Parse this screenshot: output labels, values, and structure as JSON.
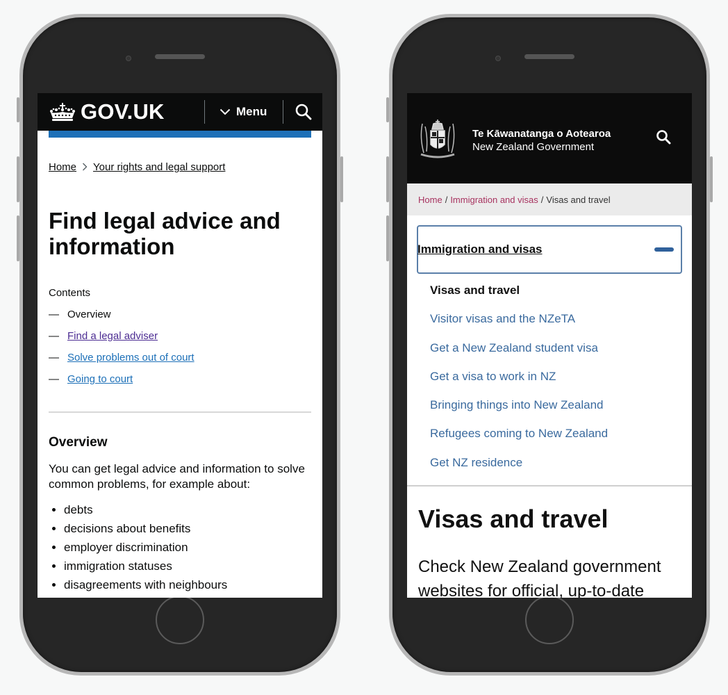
{
  "left_phone": {
    "header": {
      "logo_text": "GOV.UK",
      "menu_label": "Menu",
      "menu_icon": "chevron-down-icon",
      "search_icon": "search-icon",
      "logo_icon": "crown-icon"
    },
    "breadcrumb": [
      {
        "label": "Home"
      },
      {
        "label": "Your rights and legal support"
      }
    ],
    "breadcrumb_separator": ">",
    "title": "Find legal advice and information",
    "contents": {
      "label": "Contents",
      "items": [
        {
          "label": "Overview",
          "state": "current"
        },
        {
          "label": "Find a legal adviser",
          "state": "visited"
        },
        {
          "label": "Solve problems out of court",
          "state": "link"
        },
        {
          "label": "Going to court",
          "state": "link"
        }
      ],
      "dash": "—"
    },
    "overview": {
      "heading": "Overview",
      "paragraph": "You can get legal advice and information to solve common problems, for example about:",
      "bullets": [
        "debts",
        "decisions about benefits",
        "employer discrimination",
        "immigration statuses",
        "disagreements with neighbours"
      ]
    },
    "colors": {
      "header_bg": "#0b0c0c",
      "accent_blue": "#1d70b8",
      "link_visited": "#4c2c92"
    }
  },
  "right_phone": {
    "header": {
      "title_maori": "Te Kāwanatanga o Aotearoa",
      "title_english": "New Zealand Government",
      "crest_icon": "coat-of-arms-icon",
      "search_icon": "search-icon"
    },
    "breadcrumb": [
      {
        "label": "Home",
        "link": true
      },
      {
        "label": "Immigration and visas",
        "link": true
      },
      {
        "label": "Visas and travel",
        "link": false
      }
    ],
    "breadcrumb_separator": "/",
    "accordion": {
      "title": "Immigration and visas",
      "state": "expanded",
      "toggle_icon": "minus-icon"
    },
    "subnav": [
      {
        "label": "Visas and travel",
        "current": true
      },
      {
        "label": "Visitor visas and the NZeTA",
        "current": false
      },
      {
        "label": "Get a New Zealand student visa",
        "current": false
      },
      {
        "label": "Get a visa to work in NZ",
        "current": false
      },
      {
        "label": "Bringing things into New Zealand",
        "current": false
      },
      {
        "label": "Refugees coming to New Zealand",
        "current": false
      },
      {
        "label": "Get NZ residence",
        "current": false
      }
    ],
    "page_title": "Visas and travel",
    "lead": "Check New Zealand government websites for official, up-to-date",
    "colors": {
      "header_bg": "#0c0c0c",
      "breadcrumb_link": "#a7325f",
      "nav_link": "#3a6a9e",
      "accordion_border": "#5a7fa9"
    }
  }
}
